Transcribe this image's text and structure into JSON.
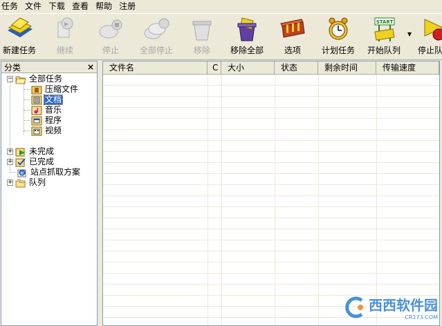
{
  "menu": {
    "items": [
      "任务",
      "文件",
      "下载",
      "查看",
      "帮助",
      "注册"
    ]
  },
  "toolbar": {
    "buttons": [
      {
        "label": "新建任务",
        "icon": "new-task-icon",
        "enabled": true
      },
      {
        "label": "继续",
        "icon": "resume-icon",
        "enabled": false
      },
      {
        "label": "停止",
        "icon": "stop-icon",
        "enabled": false
      },
      {
        "label": "全部停止",
        "icon": "stop-all-icon",
        "enabled": false
      },
      {
        "label": "移除",
        "icon": "remove-icon",
        "enabled": false
      },
      {
        "label": "移除全部",
        "icon": "remove-all-icon",
        "enabled": true
      },
      {
        "label": "选项",
        "icon": "options-icon",
        "enabled": true
      },
      {
        "label": "计划任务",
        "icon": "scheduler-icon",
        "enabled": true
      },
      {
        "label": "开始队列",
        "icon": "start-queue-icon",
        "enabled": true,
        "sign_text": "START"
      },
      {
        "label": "停止队",
        "icon": "stop-queue-icon",
        "enabled": true
      }
    ],
    "dropdown_glyph": "▼"
  },
  "sidebar": {
    "title": "分类",
    "close_glyph": "×",
    "tree": [
      {
        "label": "全部任务",
        "expander": "−",
        "icon": "folder-open-icon"
      },
      {
        "label": "压缩文件",
        "icon": "archive-icon"
      },
      {
        "label": "文档",
        "icon": "document-icon",
        "selected": true
      },
      {
        "label": "音乐",
        "icon": "music-icon"
      },
      {
        "label": "程序",
        "icon": "program-icon"
      },
      {
        "label": "视频",
        "icon": "video-icon"
      },
      {
        "label": "未完成",
        "expander": "+",
        "icon": "unfinished-icon"
      },
      {
        "label": "已完成",
        "expander": "+",
        "icon": "finished-icon"
      },
      {
        "label": "站点抓取方案",
        "icon": "site-grabber-icon"
      },
      {
        "label": "队列",
        "expander": "+",
        "icon": "queue-icon"
      }
    ]
  },
  "list": {
    "columns": [
      "文件名",
      "C",
      "大小",
      "状态",
      "剩余时间",
      "传输速度"
    ]
  },
  "watermark": {
    "text": "西西软件园",
    "sub": "CR173.COM"
  },
  "colors": {
    "window_bg": "#ece9d8",
    "selection": "#316ac5",
    "disabled_text": "#a7a7a7"
  }
}
